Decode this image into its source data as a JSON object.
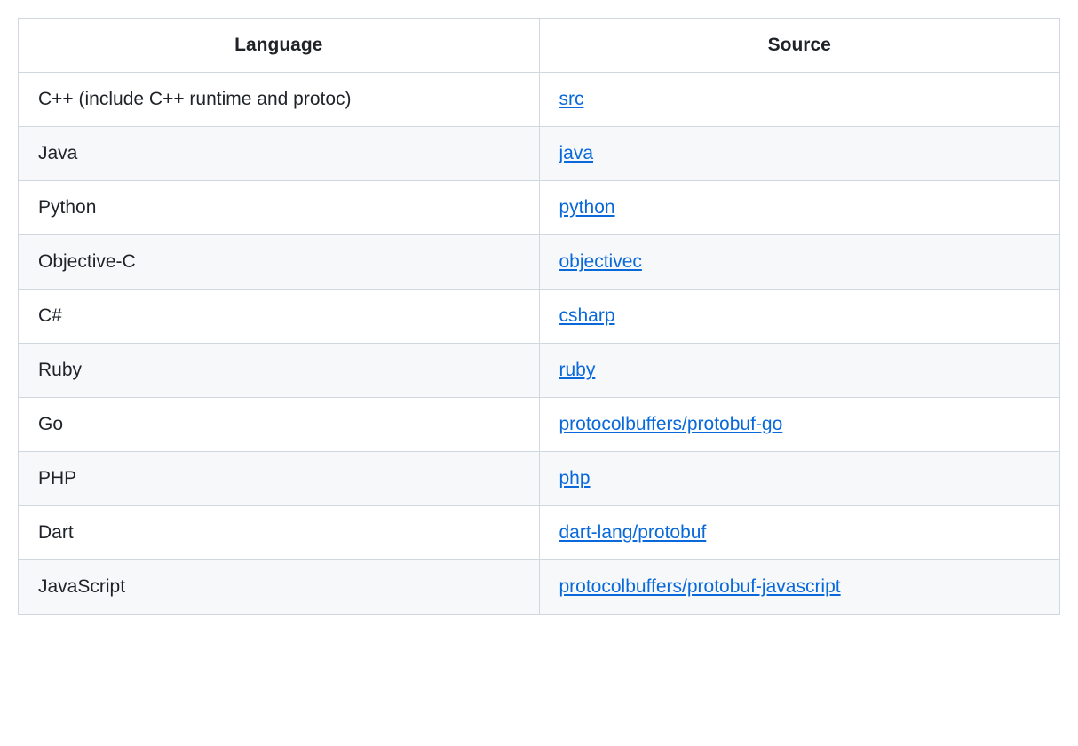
{
  "table": {
    "headers": [
      "Language",
      "Source"
    ],
    "rows": [
      {
        "language": "C++ (include C++ runtime and protoc)",
        "source": "src"
      },
      {
        "language": "Java",
        "source": "java"
      },
      {
        "language": "Python",
        "source": "python"
      },
      {
        "language": "Objective-C",
        "source": "objectivec"
      },
      {
        "language": "C#",
        "source": "csharp"
      },
      {
        "language": "Ruby",
        "source": "ruby"
      },
      {
        "language": "Go",
        "source": "protocolbuffers/protobuf-go"
      },
      {
        "language": "PHP",
        "source": "php"
      },
      {
        "language": "Dart",
        "source": "dart-lang/protobuf"
      },
      {
        "language": "JavaScript",
        "source": "protocolbuffers/protobuf-javascript"
      }
    ]
  }
}
